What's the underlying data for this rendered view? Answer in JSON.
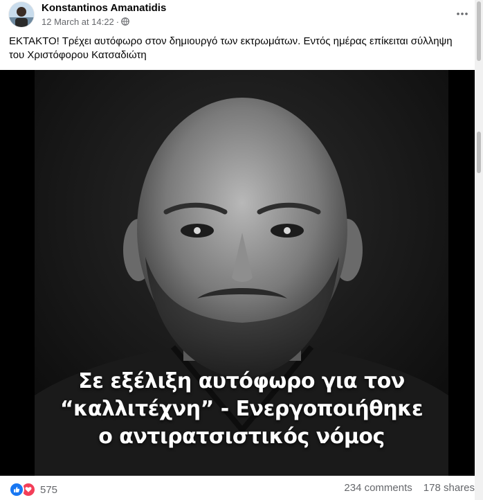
{
  "post": {
    "author": "Konstantinos Amanatidis",
    "date": "12 March at 14:22",
    "separator": "·",
    "privacy_icon": "globe-icon",
    "more_icon": "ellipsis-icon",
    "caption": "ΕΚΤΑΚΤΟ! Τρέχει αυτόφωρο στον δημιουργό των εκτρωμάτων. Εντός ημέρας επίκειται σύλληψη του Χριστόφορου Κατσαδιώτη",
    "image_text": {
      "line1": "Σε εξέλιξη αυτόφωρο για τον",
      "line2": "“καλλιτέχνη” - Ενεργοποιήθηκε",
      "line3": "ο αντιρατσιστικός νόμος"
    },
    "reactions": {
      "icons": [
        "like-icon",
        "love-icon"
      ],
      "count": "575"
    },
    "comments": "234 comments",
    "shares": "178 shares"
  },
  "colors": {
    "text_primary": "#050505",
    "text_secondary": "#65676b",
    "like_blue": "#1877f2",
    "love_red": "#f33e58"
  }
}
